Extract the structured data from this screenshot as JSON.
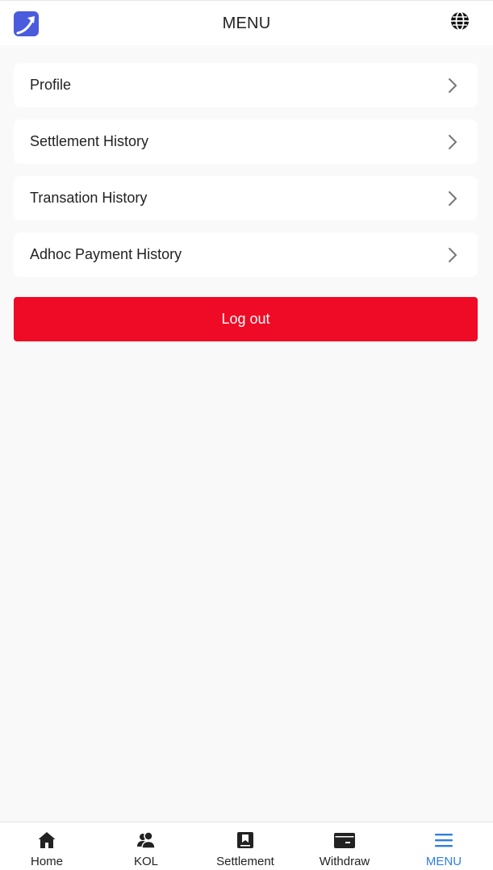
{
  "header": {
    "title": "MENU",
    "logo_icon": "trend-arrow-logo-icon",
    "language_icon": "globe-icon"
  },
  "menu": {
    "items": [
      {
        "label": "Profile",
        "icon": "chevron-right-icon"
      },
      {
        "label": "Settlement History",
        "icon": "chevron-right-icon"
      },
      {
        "label": "Transation History",
        "icon": "chevron-right-icon"
      },
      {
        "label": "Adhoc Payment History",
        "icon": "chevron-right-icon"
      }
    ],
    "logout_label": "Log out"
  },
  "bottom_nav": {
    "items": [
      {
        "label": "Home",
        "icon": "home-icon",
        "active": false
      },
      {
        "label": "KOL",
        "icon": "users-icon",
        "active": false
      },
      {
        "label": "Settlement",
        "icon": "bookmark-box-icon",
        "active": false
      },
      {
        "label": "Withdraw",
        "icon": "wallet-icon",
        "active": false
      },
      {
        "label": "MENU",
        "icon": "hamburger-icon",
        "active": true
      }
    ]
  },
  "colors": {
    "accent": "#2f7de1",
    "logout": "#ef0a25",
    "logo": "#4a5bdc",
    "background": "#f9f9f9"
  }
}
